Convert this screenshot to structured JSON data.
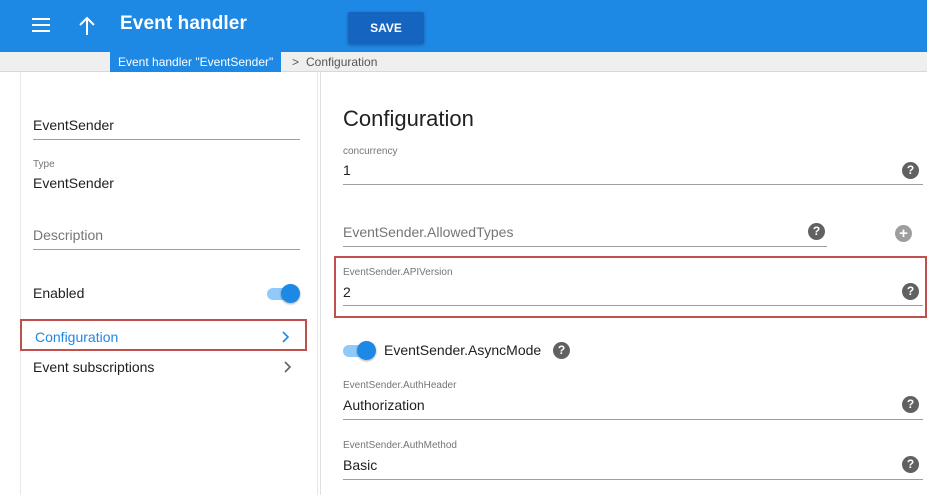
{
  "appbar": {
    "title": "Event handler",
    "menu_icon": "hamburger-menu-icon",
    "up_icon": "arrow-up-icon",
    "save_label": "SAVE",
    "color": "#1e88e5"
  },
  "breadcrumb": {
    "parent": "Event handler \"EventSender\"",
    "separator": ">",
    "current": "Configuration"
  },
  "left": {
    "name_value": "EventSender",
    "type_label": "Type",
    "type_value": "EventSender",
    "description_placeholder": "Description",
    "enabled_label": "Enabled",
    "enabled": true,
    "nav": [
      {
        "label": "Configuration",
        "active": true
      },
      {
        "label": "Event subscriptions",
        "active": false
      }
    ]
  },
  "config": {
    "title": "Configuration",
    "concurrency_label": "concurrency",
    "concurrency_value": "1",
    "allowed_types_placeholder": "EventSender.AllowedTypes",
    "api_version_label": "EventSender.APIVersion",
    "api_version_value": "2",
    "async_mode_label": "EventSender.AsyncMode",
    "async_mode": true,
    "auth_header_label": "EventSender.AuthHeader",
    "auth_header_value": "Authorization",
    "auth_method_label": "EventSender.AuthMethod",
    "auth_method_value": "Basic",
    "help_glyph": "?",
    "help_icon": "help-circle-icon",
    "add_icon": "add-circle-icon"
  },
  "colors": {
    "accent": "#1e88e5",
    "highlight": "#c0504d"
  }
}
